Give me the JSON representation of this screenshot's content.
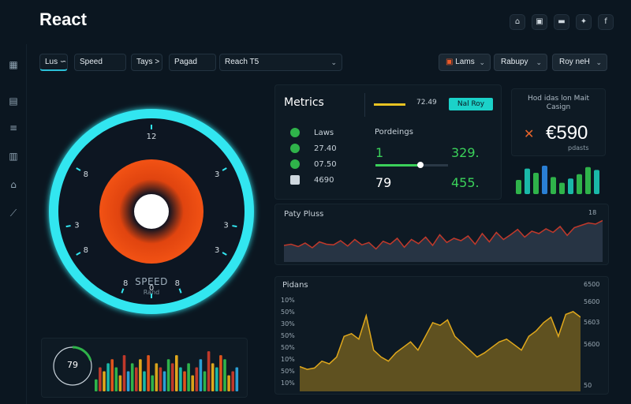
{
  "app": {
    "title": "React"
  },
  "top_icons": [
    {
      "name": "home-icon",
      "glyph": "⌂"
    },
    {
      "name": "calendar-icon",
      "glyph": "▣"
    },
    {
      "name": "folder-icon",
      "glyph": "▬"
    },
    {
      "name": "settings-icon",
      "glyph": "✦"
    },
    {
      "name": "facebook-icon",
      "glyph": "f"
    }
  ],
  "sidebar": {
    "items": [
      {
        "name": "sidebar-item-grid",
        "glyph": "▦"
      },
      {
        "name": "sidebar-item-calendar",
        "glyph": "▤"
      },
      {
        "name": "sidebar-item-list",
        "glyph": "≡"
      },
      {
        "name": "sidebar-item-building",
        "glyph": "▥"
      },
      {
        "name": "sidebar-item-home",
        "glyph": "⌂"
      },
      {
        "name": "sidebar-item-link",
        "glyph": "⟋"
      }
    ]
  },
  "filters": {
    "f1": "Lus ∽",
    "f2": "Speed",
    "f3": "Tays >",
    "f4": "Pagad",
    "f5": "Reach T5",
    "right1": "Lams",
    "right2": "Rabupy",
    "right3": "Roy neH"
  },
  "gauge": {
    "label": "SPEED",
    "sub": "Rand",
    "ticks": [
      "12",
      "3",
      "3",
      "8",
      "3",
      "3",
      "8",
      "8",
      "8",
      "0"
    ]
  },
  "metrics": {
    "title": "Metrics",
    "legend_value": "72.49",
    "legend_button": "Nal Roy",
    "rows": [
      {
        "label": "Laws",
        "icon_color": "#2fb34a"
      },
      {
        "label": "27.40",
        "icon_color": "#2fb34a"
      },
      {
        "label": "07.50",
        "icon_color": "#2fb34a"
      },
      {
        "label": "4690",
        "icon_color": "#cfd8df"
      }
    ],
    "percent_title": "Pordeings",
    "p1": "1",
    "p2": "329.",
    "p3": "79",
    "p4": "455.",
    "slider_level": 0.62
  },
  "kpi": {
    "title": "Hod idas lon Mait Casign",
    "value": "€590",
    "sub": "pdasts",
    "bars": [
      0.5,
      0.9,
      0.75,
      1.0,
      0.6,
      0.4,
      0.55,
      0.7,
      0.95,
      0.85
    ]
  },
  "colors": {
    "cyan": "#32e6f0",
    "orange": "#f24a12",
    "gold": "#d9a21a",
    "green": "#2fb34a",
    "red": "#c0392b"
  },
  "chart_data": [
    {
      "type": "area",
      "title": "Paty Pluss",
      "corner_label": "18",
      "values": [
        28,
        30,
        26,
        32,
        24,
        34,
        30,
        29,
        36,
        27,
        38,
        29,
        33,
        22,
        35,
        30,
        40,
        25,
        38,
        31,
        42,
        28,
        46,
        33,
        40,
        36,
        44,
        30,
        48,
        34,
        50,
        38,
        46,
        55,
        42,
        52,
        48,
        56,
        50,
        60,
        45,
        58,
        62,
        66,
        64,
        70
      ],
      "ylim": [
        0,
        80
      ]
    },
    {
      "type": "area",
      "title": "Pidans",
      "y_ticks_left": [
        "10%",
        "50%",
        "30%",
        "50%",
        "50%",
        "10%",
        "50%",
        "10%"
      ],
      "y_ticks_right": [
        "6500",
        "5600",
        "5603",
        "5600",
        "50"
      ],
      "values": [
        48,
        46,
        47,
        52,
        50,
        55,
        70,
        72,
        68,
        85,
        60,
        55,
        52,
        58,
        62,
        66,
        60,
        70,
        80,
        78,
        82,
        70,
        65,
        60,
        55,
        58,
        62,
        66,
        68,
        64,
        60,
        70,
        74,
        80,
        84,
        70,
        86,
        88,
        84
      ],
      "ylim": [
        30,
        100
      ]
    },
    {
      "type": "bar",
      "title": "",
      "center_value": "79",
      "ring_level": 0.2,
      "values": [
        3,
        6,
        5,
        7,
        8,
        6,
        4,
        9,
        5,
        7,
        6,
        8,
        5,
        9,
        4,
        7,
        6,
        5,
        8,
        7,
        9,
        6,
        5,
        7,
        4,
        6,
        8,
        5,
        10,
        7,
        6,
        9,
        8,
        4,
        5,
        6
      ],
      "ylim": [
        0,
        11
      ]
    }
  ]
}
